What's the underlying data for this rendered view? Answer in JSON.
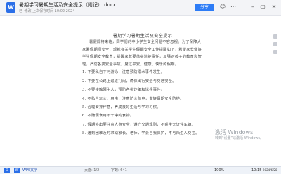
{
  "app": {
    "doc_icon_label": "W",
    "title": "暑期学习暑期生活及安全提示（附记）.docx",
    "subtitle": "已_修改  上次保存时间 10:02  2024"
  },
  "toolbar": {
    "share_label": "分享"
  },
  "document": {
    "heading": "暑期学习暑期生活及安全提示",
    "paragraphs": [
      "暑假即将来临，同学们的中小学生安全问题不容忽视。为了保障大家暑假期间安全，现就有关学生假期安全工作提醒如下，希望家长做好学生假期安全教育，提醒家长要落实监护责任，加强对孩子的教育和管理，严防各类安全事故，度过平安、健康、快乐的假期。"
    ],
    "list": [
      "1. 不要私自下河游泳，注意预防溺水事件发生。",
      "2. 不要在公路上追逐打闹，确保出行安全与交通安全。",
      "3. 不要接触陌生人，预防各类诈骗和诱拐事件。",
      "4. 不私自玩火、用电，注意防火防电，做好假期安全防护。",
      "5. 合理安排作息，养成良好生活与学习习惯。",
      "6. 不随便食用不干净的食物。",
      "7. 假期外出要注意人身安全，遵守交通规则，不乘坐无证件车辆。",
      "8. 遇到困难及时求助家长、老师，学会自我保护，不与陌生人交往。"
    ]
  },
  "watermark": {
    "line1": "激活 Windows",
    "line2": "转到“设置”以激活 Windows。"
  },
  "statusbar": {
    "page_info": "页面: 1/2",
    "words": "字数: 641",
    "app_name": "WPS文字",
    "zoom": "100%",
    "clock": "10:15",
    "date": "2024/6/28"
  }
}
